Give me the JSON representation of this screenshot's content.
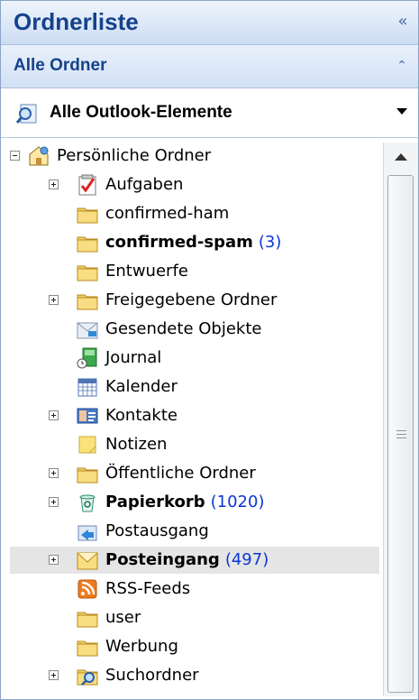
{
  "header": {
    "title": "Ordnerliste",
    "collapse_glyph": "«"
  },
  "section": {
    "title": "Alle Ordner",
    "toggle_glyph": "⌃"
  },
  "selector": {
    "label": "Alle Outlook-Elemente",
    "icon": "search-folder-icon"
  },
  "colors": {
    "header_text": "#15428b",
    "unread_count": "#0b36d9",
    "selected_row": "#e5e5e5"
  },
  "tree": {
    "root": {
      "label": "Persönliche Ordner",
      "icon": "personal-folders-icon",
      "expanded": true
    },
    "items": [
      {
        "label": "Aufgaben",
        "icon": "tasks-icon",
        "expandable": true,
        "bold": false,
        "count": ""
      },
      {
        "label": "confirmed-ham",
        "icon": "folder-icon",
        "expandable": false,
        "bold": false,
        "count": ""
      },
      {
        "label": "confirmed-spam",
        "icon": "folder-icon",
        "expandable": false,
        "bold": true,
        "count": "(3)"
      },
      {
        "label": "Entwuerfe",
        "icon": "folder-icon",
        "expandable": false,
        "bold": false,
        "count": ""
      },
      {
        "label": "Freigegebene Ordner",
        "icon": "folder-icon",
        "expandable": true,
        "bold": false,
        "count": ""
      },
      {
        "label": "Gesendete Objekte",
        "icon": "sent-items-icon",
        "expandable": false,
        "bold": false,
        "count": ""
      },
      {
        "label": "Journal",
        "icon": "journal-icon",
        "expandable": false,
        "bold": false,
        "count": ""
      },
      {
        "label": "Kalender",
        "icon": "calendar-icon",
        "expandable": false,
        "bold": false,
        "count": ""
      },
      {
        "label": "Kontakte",
        "icon": "contacts-icon",
        "expandable": true,
        "bold": false,
        "count": ""
      },
      {
        "label": "Notizen",
        "icon": "notes-icon",
        "expandable": false,
        "bold": false,
        "count": ""
      },
      {
        "label": "Öffentliche Ordner",
        "icon": "folder-icon",
        "expandable": true,
        "bold": false,
        "count": ""
      },
      {
        "label": "Papierkorb",
        "icon": "recycle-bin-icon",
        "expandable": true,
        "bold": true,
        "count": "(1020)"
      },
      {
        "label": "Postausgang",
        "icon": "outbox-icon",
        "expandable": false,
        "bold": false,
        "count": ""
      },
      {
        "label": "Posteingang",
        "icon": "inbox-icon",
        "expandable": true,
        "bold": true,
        "count": "(497)",
        "selected": true
      },
      {
        "label": "RSS-Feeds",
        "icon": "rss-icon",
        "expandable": false,
        "bold": false,
        "count": ""
      },
      {
        "label": "user",
        "icon": "folder-icon",
        "expandable": false,
        "bold": false,
        "count": ""
      },
      {
        "label": "Werbung",
        "icon": "folder-icon",
        "expandable": false,
        "bold": false,
        "count": ""
      },
      {
        "label": "Suchordner",
        "icon": "search-folders-icon",
        "expandable": true,
        "bold": false,
        "count": ""
      }
    ]
  }
}
